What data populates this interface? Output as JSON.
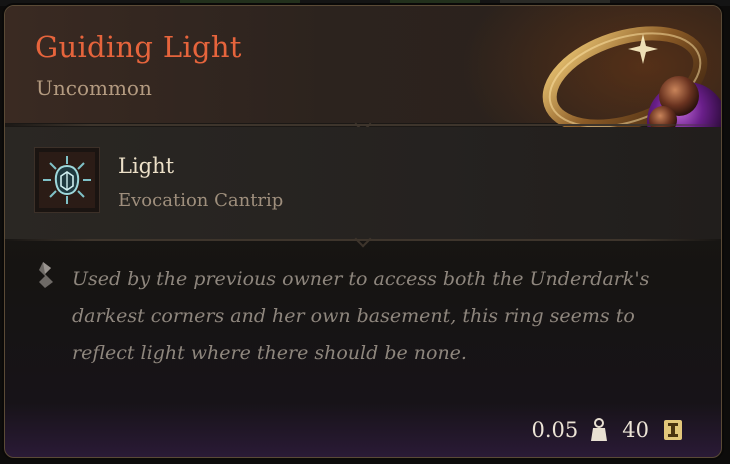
{
  "item": {
    "name": "Guiding Light",
    "rarity": "Uncommon"
  },
  "spell": {
    "name": "Light",
    "type": "Evocation Cantrip"
  },
  "description": "Used by the previous owner to access both the Underdark's darkest corners and her own basement, this ring seems to reflect light where there should be none.",
  "stats": {
    "weight": "0.05",
    "value": "40"
  },
  "icons": {
    "spell": "light-spell-icon",
    "description": "quill-icon",
    "weight": "weight-icon",
    "value": "gold-coin-icon",
    "item": "ring-icon"
  },
  "colors": {
    "title": "#e6643c",
    "rarity": "#b39a80",
    "description": "#8e867d",
    "spell_name": "#ece0c8"
  }
}
